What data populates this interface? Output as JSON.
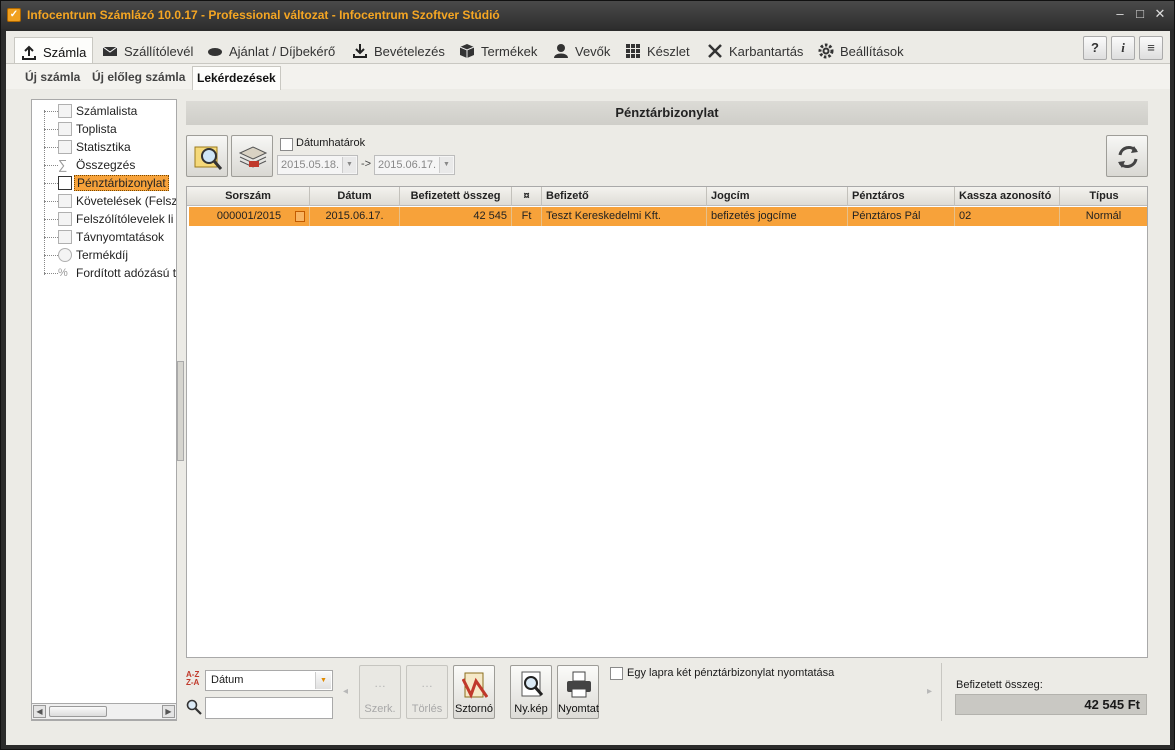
{
  "window": {
    "title": "Infocentrum Számlázó 10.0.17 - Professional változat - Infocentrum Szoftver Stúdió"
  },
  "menu": [
    {
      "label": "Számla",
      "icon": "upload-icon",
      "active": true
    },
    {
      "label": "Szállítólevél",
      "icon": "envelope-icon"
    },
    {
      "label": "Ajánlat / Díjbekérő",
      "icon": "hand-icon"
    },
    {
      "label": "Bevételezés",
      "icon": "download-icon"
    },
    {
      "label": "Termékek",
      "icon": "box-icon"
    },
    {
      "label": "Vevők",
      "icon": "user-icon"
    },
    {
      "label": "Készlet",
      "icon": "grid-icon"
    },
    {
      "label": "Karbantartás",
      "icon": "tools-icon"
    },
    {
      "label": "Beállítások",
      "icon": "gear-icon"
    }
  ],
  "help_buttons": [
    "?",
    "i",
    "≡"
  ],
  "subtabs": [
    {
      "label": "Új számla"
    },
    {
      "label": "Új előleg számla"
    },
    {
      "label": "Lekérdezések",
      "active": true
    }
  ],
  "tree": [
    {
      "label": "Számlalista",
      "icon": "list-icon"
    },
    {
      "label": "Toplista",
      "icon": "chart-icon"
    },
    {
      "label": "Statisztika",
      "icon": "stat-icon"
    },
    {
      "label": "Összegzés",
      "icon": "sigma-icon"
    },
    {
      "label": "Pénztárbizonylat",
      "icon": "receipt-icon",
      "selected": true
    },
    {
      "label": "Követelések (Felsz",
      "icon": "claims-icon"
    },
    {
      "label": "Felszólítólevelek li",
      "icon": "letter-icon"
    },
    {
      "label": "Távnyomtatások",
      "icon": "remote-print-icon"
    },
    {
      "label": "Termékdíj",
      "icon": "recycle-icon"
    },
    {
      "label": "Fordított adózású t",
      "icon": "percent-icon"
    }
  ],
  "section": {
    "title": "Pénztárbizonylat"
  },
  "filter": {
    "checkbox_label": "Dátumhatárok",
    "date_from": "2015.05.18.",
    "arrow": "->",
    "date_to": "2015.06.17."
  },
  "grid": {
    "columns": [
      "Sorszám",
      "Dátum",
      "Befizetett összeg",
      "¤",
      "Befizető",
      "Jogcím",
      "Pénztáros",
      "Kassza azonosító",
      "Típus"
    ],
    "rows": [
      [
        "000001/2015",
        "2015.06.17.",
        "42 545",
        "Ft",
        "Teszt Kereskedelmi Kft.",
        "befizetés jogcíme",
        "Pénztáros Pál",
        "02",
        "Normál"
      ]
    ]
  },
  "bottom": {
    "sort_label": "A-Z Z-A",
    "sort_value": "Dátum",
    "buttons": [
      {
        "label": "Szerk.",
        "disabled": true
      },
      {
        "label": "Törlés",
        "disabled": true
      },
      {
        "label": "Sztornó"
      },
      {
        "label": "Ny.kép"
      },
      {
        "label": "Nyomtat"
      }
    ],
    "two_per_page_label": "Egy lapra két pénztárbizonylat nyomtatása",
    "total_label": "Befizetett összeg:",
    "total_value": "42 545 Ft"
  }
}
